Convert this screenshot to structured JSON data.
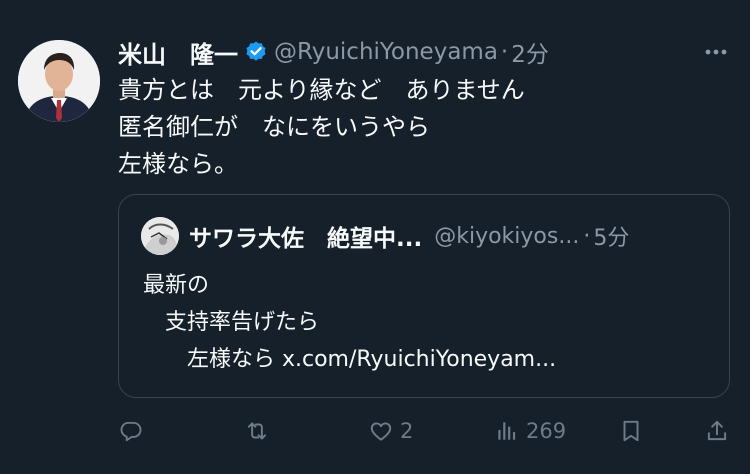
{
  "tweet": {
    "author_name": "米山　隆一",
    "handle": "@RyuichiYoneyama",
    "separator": "·",
    "time": "2分",
    "lines": [
      "貴方とは　元より縁など　ありません",
      "匿名御仁が　なにをいうやら",
      "左様なら。"
    ],
    "icons": {
      "verified": "verified-badge-icon",
      "more": "more-options-icon"
    },
    "colors": {
      "background": "#15202b",
      "verified": "#1d9bf0",
      "muted": "#8b98a5"
    }
  },
  "quote": {
    "author_name": "サワラ大佐　絶望中...",
    "handle": "@kiyokiyos...",
    "separator": "·",
    "time": "5分",
    "lines": [
      "最新の",
      "　支持率告げたら",
      "　　左様なら x.com/RyuichiYoneyam..."
    ]
  },
  "actions": {
    "reply": {
      "icon": "reply-icon",
      "count": ""
    },
    "retweet": {
      "icon": "retweet-icon",
      "count": ""
    },
    "like": {
      "icon": "heart-icon",
      "count": "2"
    },
    "views": {
      "icon": "views-chart-icon",
      "count": "269"
    },
    "bookmark": {
      "icon": "bookmark-icon",
      "count": ""
    },
    "share": {
      "icon": "share-icon",
      "count": ""
    }
  }
}
